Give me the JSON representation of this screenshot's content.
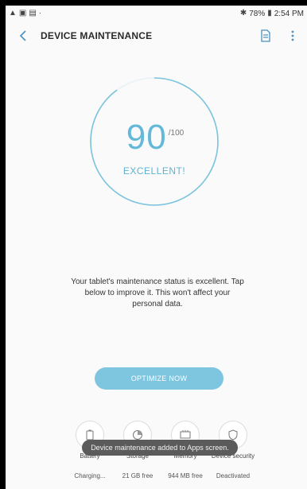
{
  "status_bar": {
    "left_icons": [
      "warning-icon",
      "screenshot-icon",
      "image-icon",
      "dot-icon"
    ],
    "battery_text": "78%",
    "time": "2:54 PM"
  },
  "app_bar": {
    "title": "DEVICE MAINTENANCE",
    "back_icon": "chevron-left-icon",
    "actions": [
      "report-icon",
      "more-vertical-icon"
    ]
  },
  "score": {
    "value": "90",
    "max": "/100",
    "label": "EXCELLENT!",
    "progress_fraction": 0.9,
    "accent_color": "#64b9d8"
  },
  "description": "Your tablet's maintenance status is excellent. Tap below to improve it. This won't affect your personal data.",
  "optimize_button": "OPTIMIZE NOW",
  "categories": [
    {
      "name": "Battery",
      "value": "Charging...",
      "icon": "battery-icon"
    },
    {
      "name": "Storage",
      "value": "21 GB free",
      "icon": "storage-icon"
    },
    {
      "name": "Memory",
      "value": "944 MB free",
      "icon": "memory-icon"
    },
    {
      "name": "Device security",
      "value": "Deactivated",
      "icon": "shield-icon"
    }
  ],
  "toast": "Device maintenance added to Apps screen."
}
